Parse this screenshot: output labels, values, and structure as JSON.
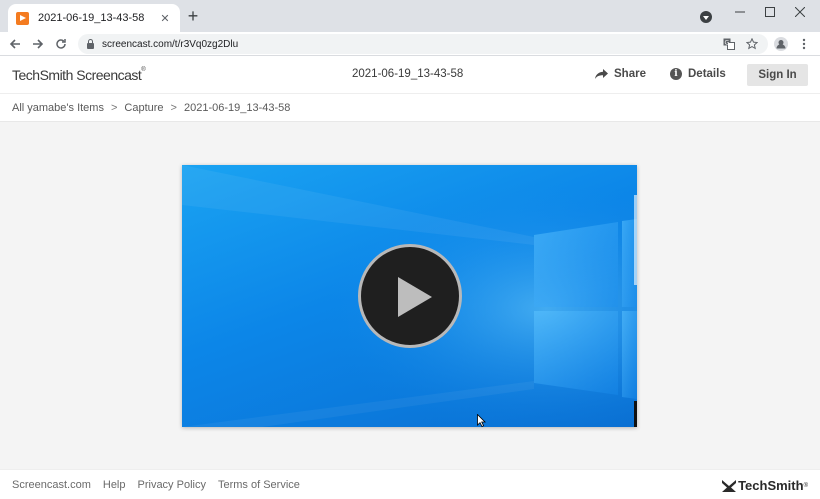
{
  "browser": {
    "tab": {
      "title": "2021-06-19_13-43-58",
      "close": "✕"
    },
    "new_tab": "+",
    "url": "screencast.com/t/r3Vq0zg2Dlu",
    "window_controls": {
      "minimize": "–",
      "maximize": "☐",
      "close": "✕"
    }
  },
  "header": {
    "logo": "TechSmith Screencast",
    "logo_mark": "®",
    "title": "2021-06-19_13-43-58",
    "share_label": "Share",
    "details_label": "Details",
    "signin_label": "Sign In"
  },
  "breadcrumb": {
    "items": [
      "All yamabe's Items",
      "Capture",
      "2021-06-19_13-43-58"
    ],
    "separator": ">"
  },
  "video": {
    "background_colors": [
      "#1aa3f2",
      "#0c86e8",
      "#0a6fd2"
    ]
  },
  "footer": {
    "links": [
      "Screencast.com",
      "Help",
      "Privacy Policy",
      "Terms of Service"
    ],
    "brand": "TechSmith",
    "brand_mark": "®"
  },
  "icons": [
    "tab-favicon-icon",
    "new-tab-icon",
    "profile-icon",
    "back-arrow-icon",
    "forward-arrow-icon",
    "reload-icon",
    "lock-icon",
    "translate-icon",
    "star-icon",
    "account-icon",
    "menu-dots-icon",
    "share-arrow-icon",
    "info-icon",
    "play-icon",
    "cursor-icon",
    "techsmith-logo-icon"
  ]
}
